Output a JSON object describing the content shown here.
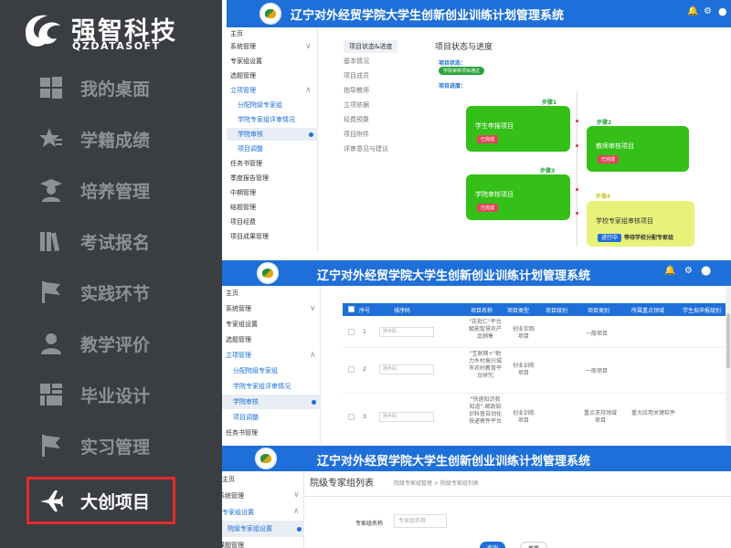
{
  "colors": {
    "header_blue": "#1e6fd9",
    "sidebar_dark": "#3a3d42",
    "card_green": "#34c018",
    "card_yellow": "#e8f27a",
    "highlight_red": "#e12b2b"
  },
  "left_sidebar": {
    "logo_cn": "强智科技",
    "logo_en": "QZDATASOFT",
    "items": [
      {
        "label": "我的桌面",
        "icon": "windows-icon"
      },
      {
        "label": "学籍成绩",
        "icon": "star-icon"
      },
      {
        "label": "培养管理",
        "icon": "graduate-icon"
      },
      {
        "label": "考试报名",
        "icon": "books-icon"
      },
      {
        "label": "实践环节",
        "icon": "flag-icon"
      },
      {
        "label": "教学评价",
        "icon": "user-icon"
      },
      {
        "label": "毕业设计",
        "icon": "grid-icon"
      },
      {
        "label": "实习管理",
        "icon": "flag-icon"
      },
      {
        "label": "大创项目",
        "icon": "plane-icon"
      }
    ]
  },
  "system_title": "辽宁对外经贸学院大学生创新创业训练计划管理系统",
  "panel1": {
    "nav": [
      "主页",
      "系统管理",
      "专家组设置",
      "选题管理",
      "立项管理",
      "分配院级专家组",
      "学院专家组评审情况",
      "学院审核",
      "项目调整",
      "任务书管理",
      "季度报告管理",
      "中期管理",
      "结题管理",
      "项目经费",
      "项目成果管理"
    ],
    "tabs": [
      "项目状态&进度",
      "基本情况",
      "项目成员",
      "指导教师",
      "立项依据",
      "经费预算",
      "项目附件",
      "评审意见与建议"
    ],
    "heading": "项目状态与进度",
    "status_label": "项目状态：",
    "status_value": "学院审核项目通过",
    "progress_label": "项目进度：",
    "steps": [
      "步骤1",
      "步骤2",
      "步骤3",
      "步骤4"
    ],
    "cards": [
      {
        "title": "学生申报项目",
        "badge": "已完成"
      },
      {
        "title": "教师审核项目",
        "badge": "已完成"
      },
      {
        "title": "学院审核项目",
        "badge": "已完成"
      },
      {
        "title": "学校专家组审核项目",
        "badge": "进行中",
        "note": "等待学校分配专家组"
      }
    ]
  },
  "panel2": {
    "nav": [
      "主页",
      "系统管理",
      "专家组设置",
      "选题管理",
      "立项管理",
      "分配院级专家组",
      "学院专家组评审情况",
      "学院审核",
      "项目调整",
      "任务书管理"
    ],
    "columns": [
      "序号",
      "排序码",
      "项目名称",
      "项目类型",
      "项目级别",
      "项目类别",
      "所属重点领域",
      "学生拟申报级别"
    ],
    "rows": [
      {
        "no": "1",
        "sort_placeholder": "排序码",
        "name": "\"花批仁\"平台赋能智慧农产品销售",
        "type": "创业实践项目",
        "category": "一般项目",
        "field": ""
      },
      {
        "no": "2",
        "sort_placeholder": "排序码",
        "name": "\"互联网+\"助力乡村振兴城市农村教育平台研究",
        "type": "创业训练项目",
        "category": "一般项目",
        "field": ""
      },
      {
        "no": "3",
        "sort_placeholder": "排序码",
        "name": "\"快递知识我知道\"-邮政知识科普自动化快递寄件平台",
        "type": "创业训练项目",
        "category": "重点支持领域项目",
        "field": "重大应用关键软件"
      }
    ]
  },
  "panel3": {
    "nav": [
      "主页",
      "系统管理",
      "专家组设置",
      "院级专家组设置",
      "课题管理"
    ],
    "page_title": "院级专家组列表",
    "breadcrumb": "院级专家组管理 > 院级专家组列表",
    "field_label": "专家组名称",
    "field_placeholder": "专家组名称",
    "query_button": "查询",
    "reset_button": "重置"
  }
}
